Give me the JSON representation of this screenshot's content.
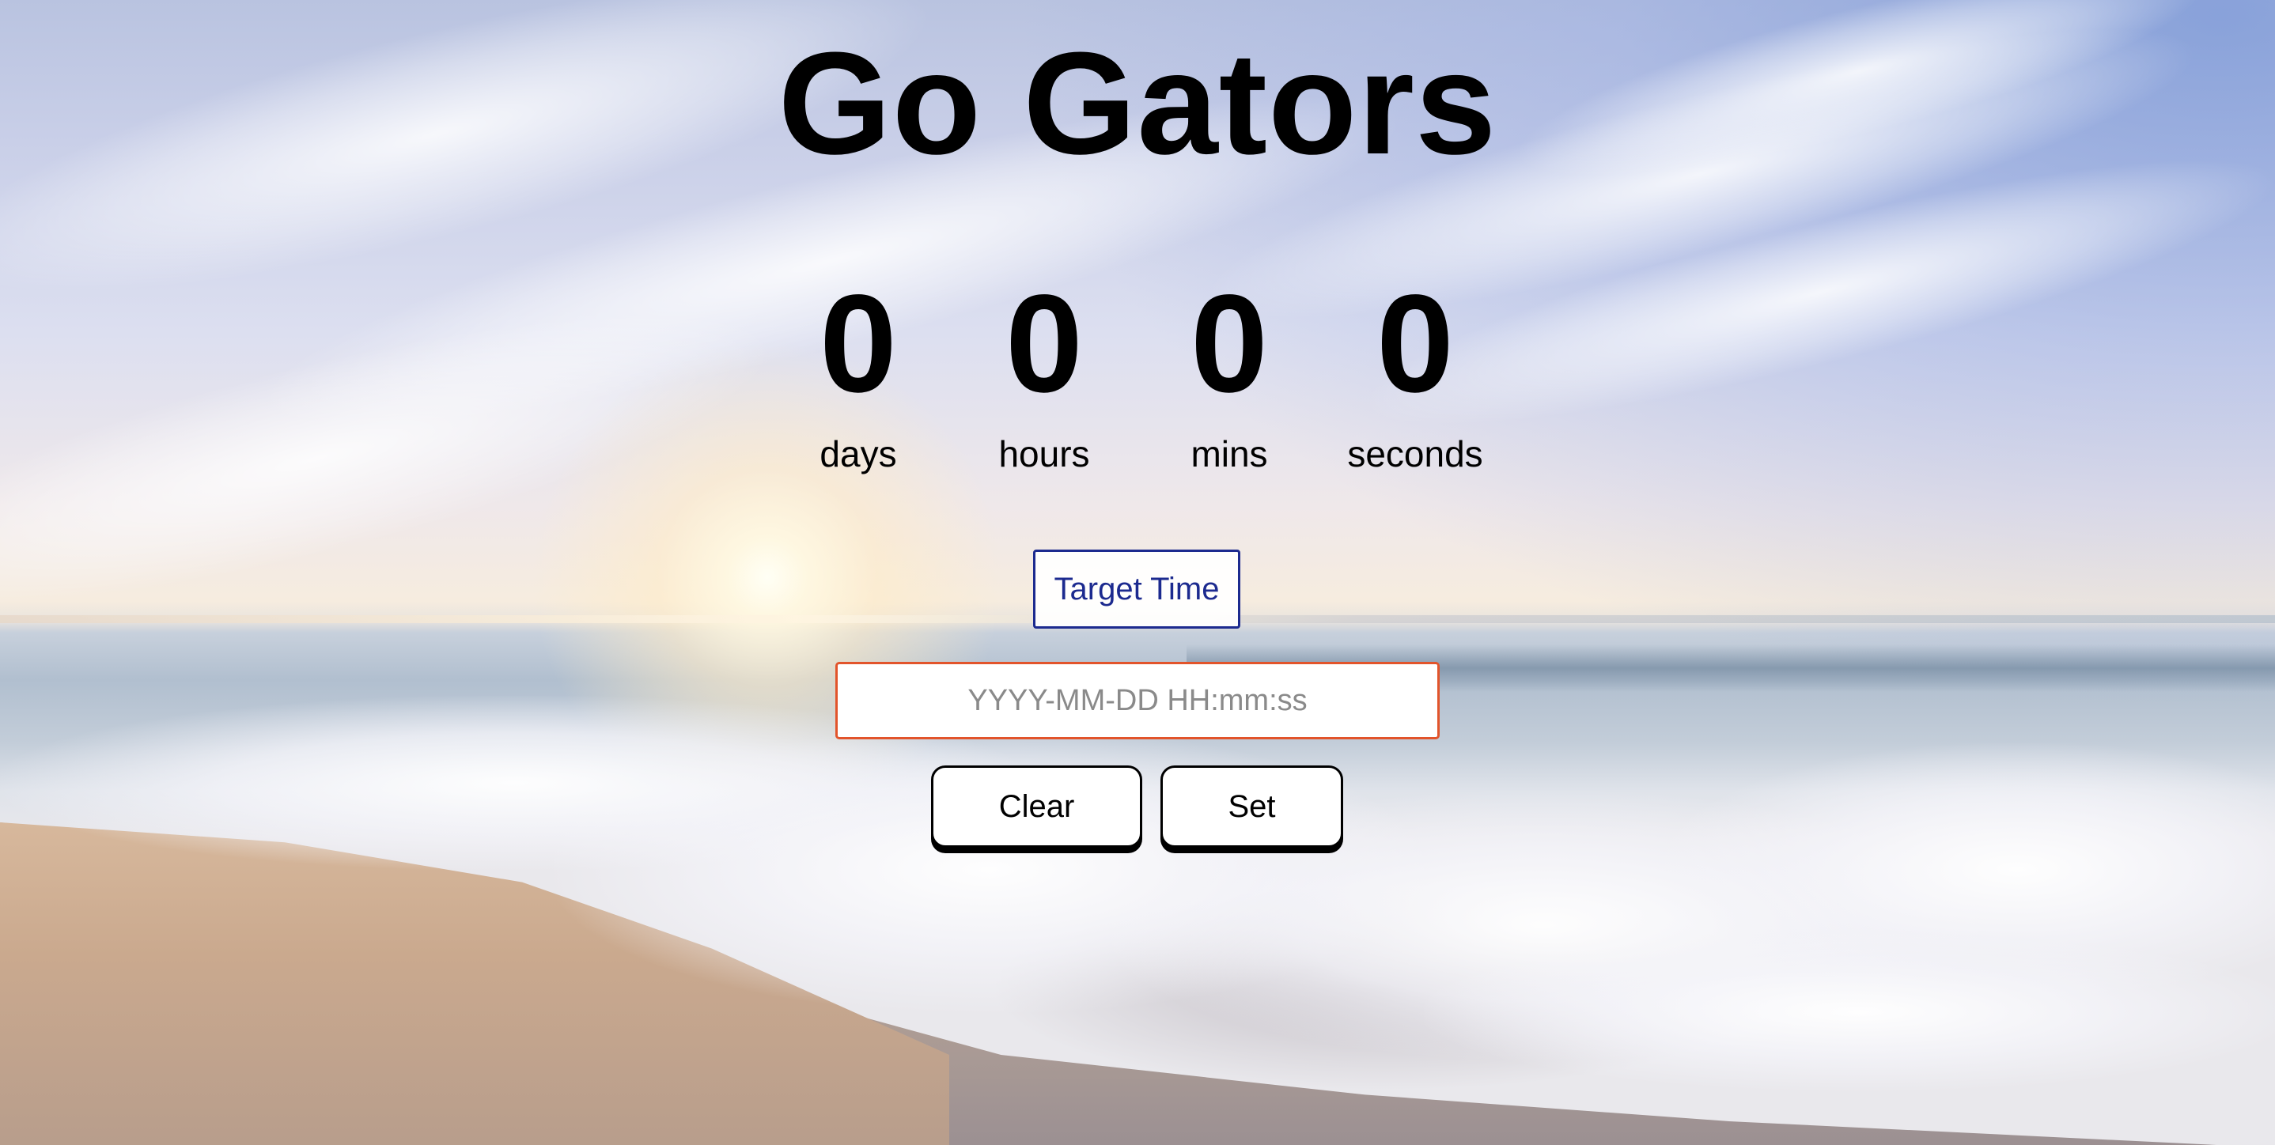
{
  "title": "Go Gators",
  "countdown": [
    {
      "value": "0",
      "label": "days"
    },
    {
      "value": "0",
      "label": "hours"
    },
    {
      "value": "0",
      "label": "mins"
    },
    {
      "value": "0",
      "label": "seconds"
    }
  ],
  "target_button_label": "Target Time",
  "time_input": {
    "placeholder": "YYYY-MM-DD HH:mm:ss",
    "value": ""
  },
  "buttons": {
    "clear_label": "Clear",
    "set_label": "Set"
  },
  "colors": {
    "target_button_border": "#1c2a8f",
    "input_border": "#e2542b",
    "text": "#000000"
  }
}
